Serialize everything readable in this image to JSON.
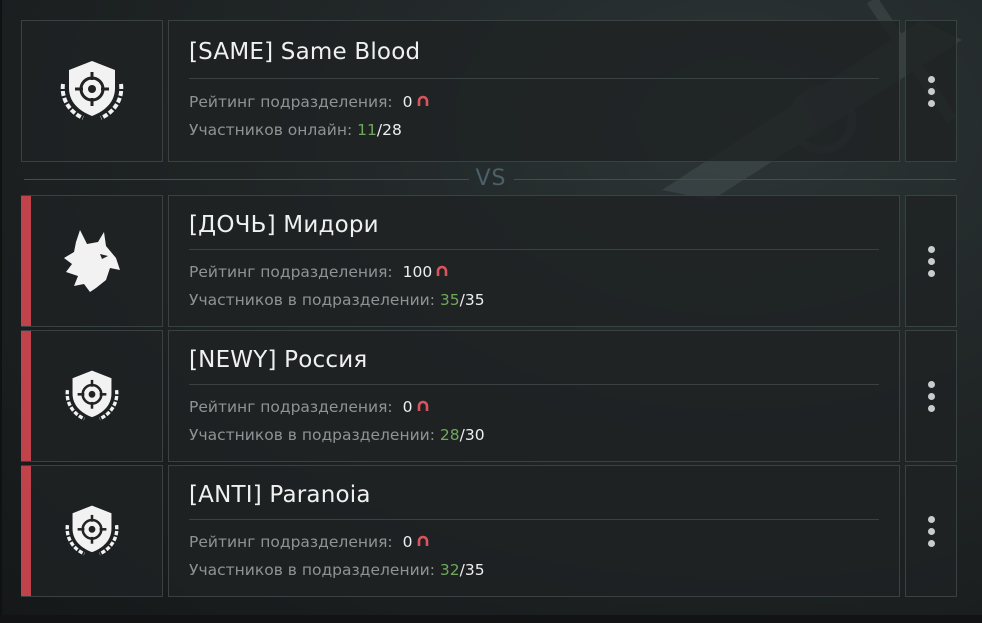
{
  "own_unit": {
    "tag_name": "[SAME] Same Blood",
    "rating_label": "Рейтинг подразделения:",
    "rating_value": "0",
    "members_label": "Участников онлайн:",
    "members_current": "11",
    "members_max": "28",
    "emblem": "crosshair-shield-emblem"
  },
  "vs_label": "VS",
  "opponents": [
    {
      "tag_name": "[ДОЧЬ] Мидори",
      "rating_label": "Рейтинг подразделения:",
      "rating_value": "100",
      "members_label": "Участников в подразделении:",
      "members_current": "35",
      "members_max": "35",
      "emblem": "wolf-emblem"
    },
    {
      "tag_name": "[NEWY] Россия",
      "rating_label": "Рейтинг подразделения:",
      "rating_value": "0",
      "members_label": "Участников в подразделении:",
      "members_current": "28",
      "members_max": "30",
      "emblem": "crosshair-shield-emblem"
    },
    {
      "tag_name": "[ANTI] Paranoia",
      "rating_label": "Рейтинг подразделения:",
      "rating_value": "0",
      "members_label": "Участников в подразделении:",
      "members_current": "32",
      "members_max": "35",
      "emblem": "crosshair-shield-emblem"
    }
  ],
  "colors": {
    "accent_red": "#c0424a",
    "members_green": "#6fa85d",
    "label_gray": "#8e9494",
    "vs_color": "#4c6068"
  },
  "icons": {
    "rating": "rating-horseshoe-icon",
    "menu": "more-vertical-icon"
  }
}
